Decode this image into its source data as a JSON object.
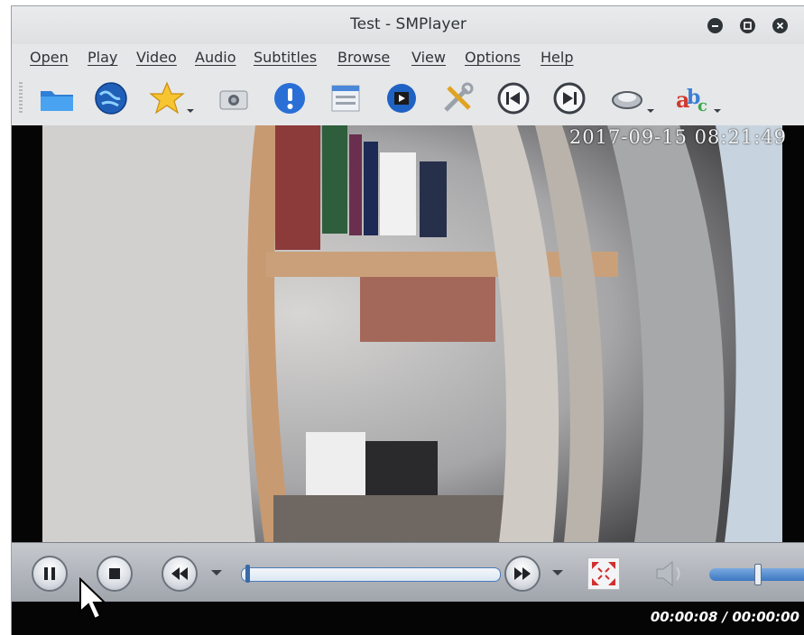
{
  "window": {
    "title": "Test - SMPlayer",
    "controls": [
      "minimize-icon",
      "maximize-icon",
      "close-icon"
    ]
  },
  "menubar": {
    "items": [
      {
        "label": "Open"
      },
      {
        "label": "Play"
      },
      {
        "label": "Video"
      },
      {
        "label": "Audio"
      },
      {
        "label": "Subtitles"
      },
      {
        "label": "Browse"
      },
      {
        "label": "View"
      },
      {
        "label": "Options"
      },
      {
        "label": "Help"
      }
    ]
  },
  "toolbar": {
    "buttons": [
      {
        "icon": "open-folder-icon"
      },
      {
        "icon": "open-url-globe-icon"
      },
      {
        "icon": "favorites-star-icon",
        "has_dropdown": true
      },
      {
        "icon": "screenshot-camera-icon"
      },
      {
        "icon": "info-icon"
      },
      {
        "icon": "playlist-icon"
      },
      {
        "icon": "video-clapper-icon"
      },
      {
        "icon": "preferences-tools-icon"
      },
      {
        "icon": "previous-icon"
      },
      {
        "icon": "next-icon"
      },
      {
        "icon": "audio-track-icon",
        "has_dropdown": true
      },
      {
        "icon": "subtitles-abc-icon",
        "has_dropdown": true
      }
    ]
  },
  "video": {
    "osd_timestamp": "2017-09-15 08:21:49"
  },
  "controls": {
    "buttons": [
      "pause-icon",
      "stop-icon",
      "rewind-icon",
      "forward-icon",
      "fullscreen-icon",
      "volume-icon"
    ],
    "seek_position": 0.0,
    "volume_level": 0.5
  },
  "status": {
    "time_display": "00:00:08 / 00:00:00"
  },
  "colors": {
    "accent": "#3a6aa8",
    "window_bg": "#e6e7e9",
    "status_bg": "#050505"
  }
}
